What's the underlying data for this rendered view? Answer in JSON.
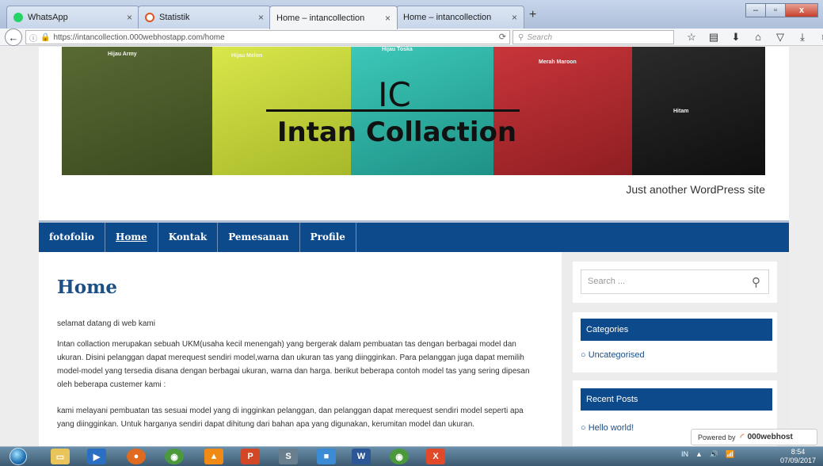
{
  "browser": {
    "tabs": [
      {
        "title": "WhatsApp",
        "icon": "whatsapp-icon",
        "color": "#25d366"
      },
      {
        "title": "Statistik",
        "icon": "000webhost-icon",
        "color": "#e2531d"
      },
      {
        "title": "Home – intancollection",
        "icon": "",
        "color": ""
      },
      {
        "title": "Home – intancollection",
        "icon": "",
        "color": ""
      }
    ],
    "new_tab": "+",
    "url": "https://intancollection.000webhostapp.com/home",
    "url_host_bold": "000webhostapp.com",
    "search_placeholder": "Search"
  },
  "site": {
    "logo_ic": "IC",
    "logo_name": "Intan Collaction",
    "bag_labels": [
      "Hijau Army",
      "Hijau Melon",
      "Hijau Toska",
      "Merah Maroon",
      "Hitam"
    ],
    "tagline": "Just another WordPress site",
    "nav": [
      "fotofolio",
      "Home",
      "Kontak",
      "Pemesanan",
      "Profile"
    ],
    "page_title": "Home",
    "paragraphs": [
      "selamat datang di web kami",
      "Intan collaction merupakan sebuah UKM(usaha kecil menengah) yang bergerak dalam pembuatan tas dengan berbagai model dan ukuran. Disini pelanggan dapat merequest sendiri model,warna dan ukuran tas yang diingginkan. Para pelanggan juga dapat memilih model-model yang tersedia disana dengan berbagai ukuran, warna dan harga. berikut beberapa contoh model tas yang sering dipesan oleh beberapa custemer kami :",
      "kami melayani pembuatan tas sesuai model yang di ingginkan pelanggan, dan pelanggan dapat merequest sendiri model seperti apa yang diingginkan. Untuk harganya sendiri dapat dihitung dari bahan apa yang digunakan, kerumitan model dan ukuran."
    ],
    "sidebar": {
      "search_placeholder": "Search ...",
      "categories_title": "Categories",
      "categories": [
        "Uncategorised"
      ],
      "recent_title": "Recent Posts",
      "recent": [
        "Hello world!"
      ]
    },
    "powered_by": "Powered by",
    "powered_brand": "000webhost"
  },
  "taskbar": {
    "tray": [
      "IN",
      "▲",
      "🔊",
      "📶"
    ],
    "time": "8:54",
    "date": "07/09/2017"
  },
  "colors": {
    "nav_bg": "#0c4a8c",
    "title_color": "#1b4f86",
    "bags": [
      "#4a5a2a",
      "#c9d636",
      "#2bb3a4",
      "#b22a2e",
      "#1f1f1f"
    ]
  }
}
